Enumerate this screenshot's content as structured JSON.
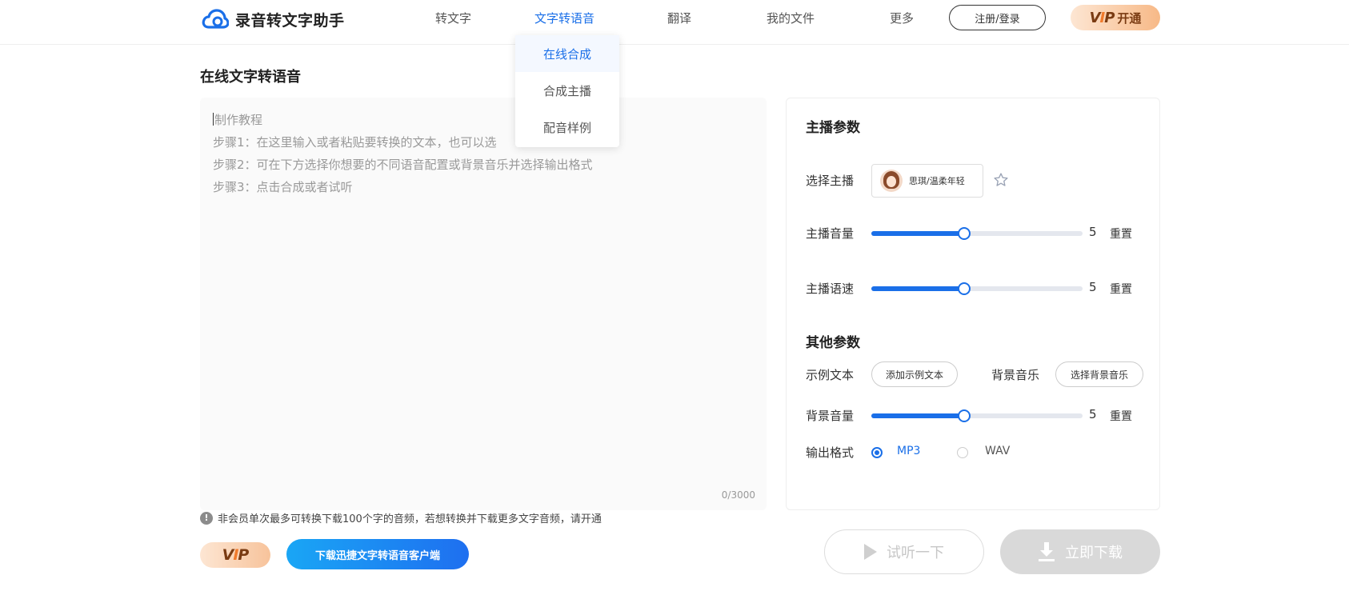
{
  "header": {
    "app_name": "录音转文字助手",
    "nav": [
      "转文字",
      "文字转语音",
      "翻译",
      "我的文件",
      "更多"
    ],
    "login_label": "注册/登录",
    "vip_badge": {
      "v": "V",
      "i": "I",
      "p": "P",
      "open": "开通"
    }
  },
  "dropdown": {
    "items": [
      "在线合成",
      "合成主播",
      "配音样例"
    ],
    "active": "在线合成"
  },
  "editor": {
    "title": "在线文字转语音",
    "lines": [
      "制作教程",
      "步骤1：在这里输入或者粘贴要转换的文本，也可以选",
      "步骤2：可在下方选择你想要的不同语音配置或背景音乐并选择输出格式",
      "步骤3：点击合成或者试听"
    ],
    "counter": "0/3000",
    "notice_icon": "!",
    "notice": "非会员单次最多可转换下载100个字的音频，若想转换并下载更多文字音频，请开通",
    "vip_pill": {
      "v": "V",
      "i": "I",
      "p": "P"
    },
    "download_client_label": "下载迅捷文字转语音客户端"
  },
  "settings": {
    "anchor_section_title": "主播参数",
    "select_anchor_label": "选择主播",
    "anchor_name": "思琪/温柔年轻",
    "volume_label": "主播音量",
    "volume_value": "5",
    "volume_fraction": 0.44,
    "speed_label": "主播语速",
    "speed_value": "5",
    "speed_fraction": 0.44,
    "reset_label": "重置",
    "other_section_title": "其他参数",
    "sample_text_label": "示例文本",
    "add_sample_label": "添加示例文本",
    "bg_music_label": "背景音乐",
    "choose_bg_music_label": "选择背景音乐",
    "bg_volume_label": "背景音量",
    "bg_volume_value": "5",
    "bg_volume_fraction": 0.44,
    "output_format_label": "输出格式",
    "formats": [
      "MP3",
      "WAV"
    ],
    "selected_format": "MP3"
  },
  "actions": {
    "preview_label": "试听一下",
    "download_label": "立即下载"
  },
  "icons": {
    "logo": "cloud-icon",
    "star": "star-icon",
    "play": "play-icon",
    "download": "download-icon",
    "info": "info-icon"
  },
  "colors": {
    "accent": "#1a6fe8",
    "vip_gold": "#f7b987",
    "disabled": "#d9d9d9"
  }
}
